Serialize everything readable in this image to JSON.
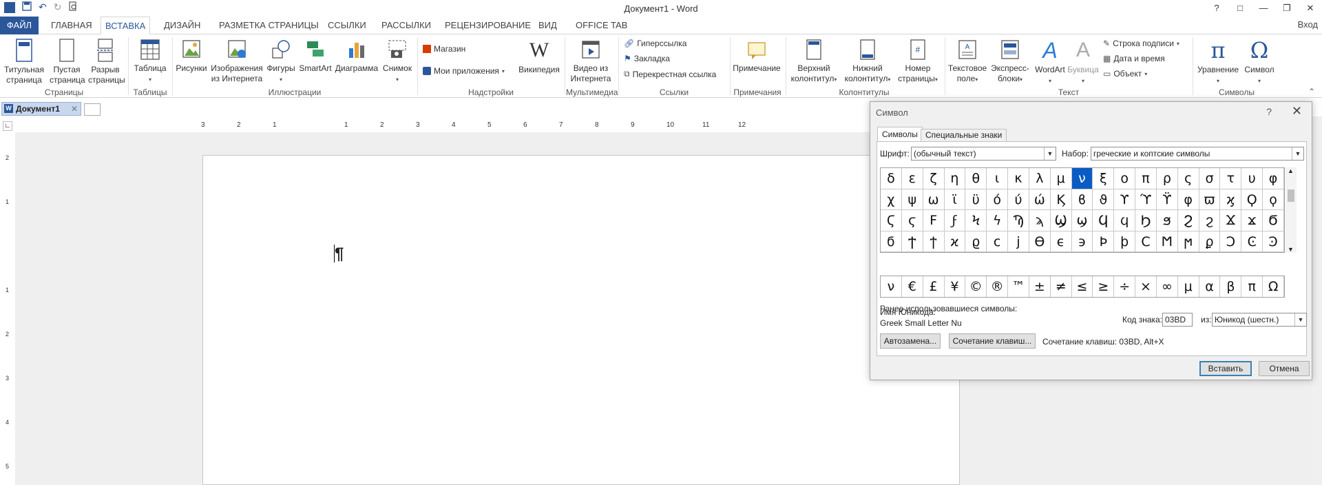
{
  "titlebar": {
    "title": "Документ1 - Word",
    "app_icon": "word-icon"
  },
  "window_controls": [
    "?",
    "□",
    "—",
    "❐",
    "✕"
  ],
  "tabs": [
    {
      "label": "ФАЙЛ"
    },
    {
      "label": "ГЛАВНАЯ"
    },
    {
      "label": "ВСТАВКА"
    },
    {
      "label": "ДИЗАЙН"
    },
    {
      "label": "РАЗМЕТКА СТРАНИЦЫ"
    },
    {
      "label": "ССЫЛКИ"
    },
    {
      "label": "РАССЫЛКИ"
    },
    {
      "label": "РЕЦЕНЗИРОВАНИЕ"
    },
    {
      "label": "ВИД"
    },
    {
      "label": "OFFICE TAB"
    }
  ],
  "login": "Вход",
  "ribbon": {
    "pages": {
      "title_page": "Титульная",
      "title_page2": "страница",
      "blank": "Пустая",
      "blank2": "страница",
      "break": "Разрыв",
      "break2": "страницы",
      "group": "Страницы"
    },
    "tables": {
      "table": "Таблица",
      "group": "Таблицы"
    },
    "illustrations": {
      "pictures": "Рисунки",
      "online1": "Изображения",
      "online2": "из Интернета",
      "shapes": "Фигуры",
      "smartart": "SmartArt",
      "chart": "Диаграмма",
      "screenshot": "Снимок",
      "group": "Иллюстрации"
    },
    "addins": {
      "store": "Магазин",
      "myapps": "Мои приложения",
      "wiki": "Википедия",
      "group": "Надстройки"
    },
    "media": {
      "video1": "Видео из",
      "video2": "Интернета",
      "group": "Мультимедиа"
    },
    "links": {
      "hyperlink": "Гиперссылка",
      "bookmark": "Закладка",
      "crossref": "Перекрестная ссылка",
      "group": "Ссылки"
    },
    "comments": {
      "comment": "Примечание",
      "group": "Примечания"
    },
    "headerfooter": {
      "header1": "Верхний",
      "header2": "колонтитул",
      "footer1": "Нижний",
      "footer2": "колонтитул",
      "pagenum1": "Номер",
      "pagenum2": "страницы",
      "group": "Колонтитулы"
    },
    "text": {
      "textbox1": "Текстовое",
      "textbox2": "поле",
      "quick1": "Экспресс-",
      "quick2": "блоки",
      "wordart": "WordArt",
      "dropcap": "Буквица",
      "sigline": "Строка подписи",
      "datetime": "Дата и время",
      "object": "Объект",
      "group": "Текст"
    },
    "symbols": {
      "equation": "Уравнение",
      "symbol": "Символ",
      "group": "Символы"
    }
  },
  "doctab": {
    "active": "Документ1"
  },
  "ruler": {
    "h_labels": [
      "3",
      "2",
      "1",
      "1",
      "2",
      "3",
      "4",
      "5",
      "6",
      "7",
      "8",
      "9",
      "10",
      "11",
      "12"
    ],
    "v_labels": [
      "2",
      "1",
      "1",
      "2",
      "3",
      "4",
      "5"
    ]
  },
  "document": {
    "pilcrow": "¶"
  },
  "dialog": {
    "title": "Символ",
    "help": "?",
    "close": "✕",
    "tab_symbols": "Символы",
    "tab_special": "Специальные знаки",
    "font_label": "Шрифт:",
    "font_value": "(обычный текст)",
    "subset_label": "Набор:",
    "subset_value": "греческие и коптские символы",
    "grid": [
      [
        "δ",
        "ε",
        "ζ",
        "η",
        "θ",
        "ι",
        "κ",
        "λ",
        "μ",
        "ν",
        "ξ",
        "ο",
        "π",
        "ρ",
        "ς",
        "σ",
        "τ",
        "υ",
        "φ"
      ],
      [
        "χ",
        "ψ",
        "ω",
        "ϊ",
        "ϋ",
        "ό",
        "ύ",
        "ώ",
        "Ϗ",
        "ϐ",
        "ϑ",
        "ϒ",
        "ϓ",
        "ϔ",
        "φ",
        "ϖ",
        "ϗ",
        "Ϙ",
        "ϙ"
      ],
      [
        "Ϛ",
        "ϛ",
        "Ϝ",
        "ϝ",
        "Ϟ",
        "ϟ",
        "Ϡ",
        "ϡ",
        "Ϣ",
        "ϣ",
        "Ϥ",
        "ϥ",
        "Ϧ",
        "ϧ",
        "Ϩ",
        "ϩ",
        "Ϫ",
        "ϫ",
        "Ϭ"
      ],
      [
        "ϭ",
        "Ϯ",
        "ϯ",
        "ϰ",
        "ϱ",
        "ϲ",
        "ϳ",
        "ϴ",
        "ϵ",
        "϶",
        "Ϸ",
        "ϸ",
        "Ϲ",
        "Ϻ",
        "ϻ",
        "ϼ",
        "Ͻ",
        "Ͼ",
        "Ͽ"
      ]
    ],
    "selected": "ν",
    "recent_label": "Ранее использовавшиеся символы:",
    "recent": [
      "ν",
      "€",
      "£",
      "¥",
      "©",
      "®",
      "™",
      "±",
      "≠",
      "≤",
      "≥",
      "÷",
      "×",
      "∞",
      "μ",
      "α",
      "β",
      "π",
      "Ω"
    ],
    "unicode_name_label": "Имя Юникода:",
    "unicode_name": "Greek Small Letter Nu",
    "code_label": "Код знака:",
    "code_value": "03BD",
    "from_label": "из:",
    "from_value": "Юникод (шестн.)",
    "autocorrect": "Автозамена...",
    "shortcut_btn": "Сочетание клавиш...",
    "shortcut_text": "Сочетание клавиш: 03BD, Alt+X",
    "insert": "Вставить",
    "cancel": "Отмена"
  }
}
